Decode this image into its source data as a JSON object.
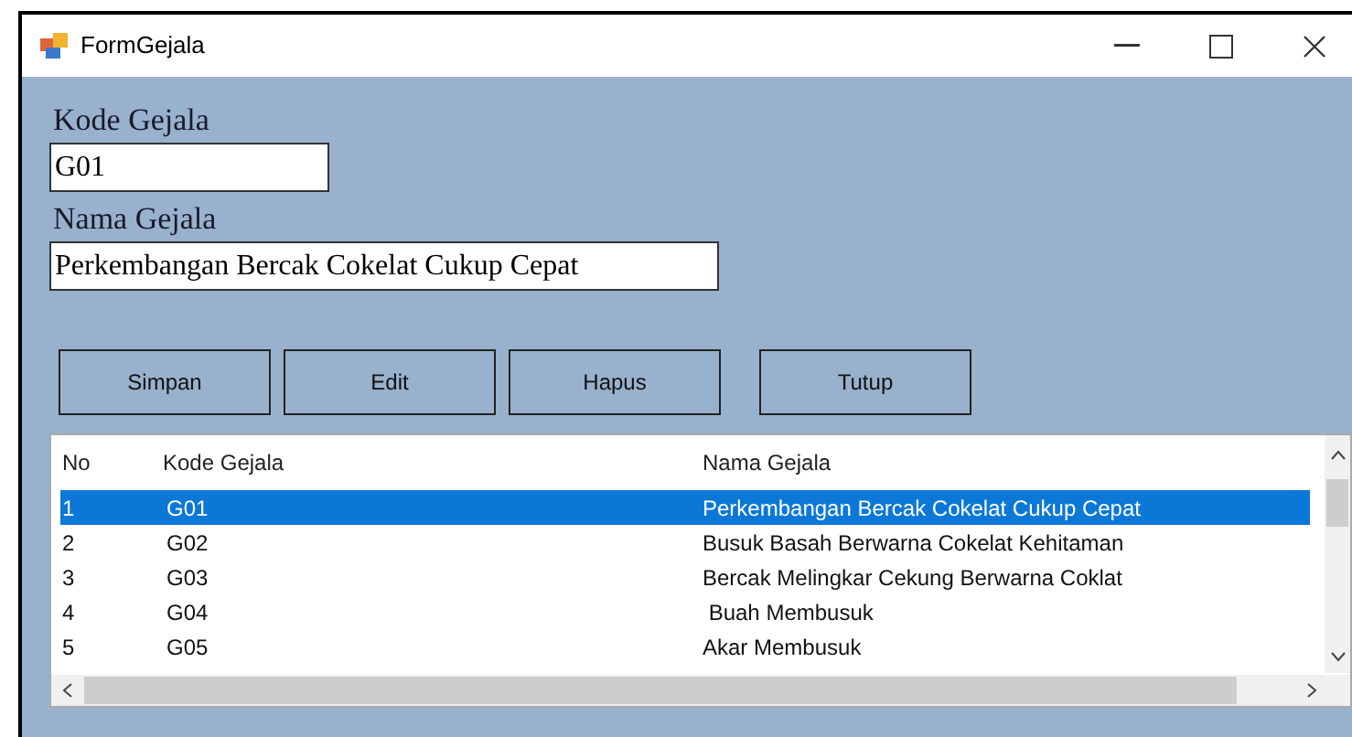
{
  "window": {
    "title": "FormGejala"
  },
  "fields": [
    {
      "label": "Kode Gejala",
      "value": "G01"
    },
    {
      "label": "Nama Gejala",
      "value": "Perkembangan Bercak Cokelat Cukup Cepat"
    }
  ],
  "buttons": [
    "Simpan",
    "Edit",
    "Hapus",
    "Tutup"
  ],
  "table": {
    "columns": [
      "No",
      "Kode Gejala",
      "Nama Gejala"
    ],
    "rows": [
      {
        "cells": [
          "1",
          "G01",
          "Perkembangan Bercak Cokelat Cukup Cepat"
        ],
        "selected": true
      },
      {
        "cells": [
          "2",
          "G02",
          "Busuk Basah Berwarna Cokelat Kehitaman"
        ],
        "selected": false
      },
      {
        "cells": [
          "3",
          "G03",
          "Bercak Melingkar Cekung Berwarna Coklat"
        ],
        "selected": false
      },
      {
        "cells": [
          "4",
          "G04",
          " Buah Membusuk"
        ],
        "selected": false
      },
      {
        "cells": [
          "5",
          "G05",
          "Akar Membusuk"
        ],
        "selected": false
      }
    ]
  }
}
